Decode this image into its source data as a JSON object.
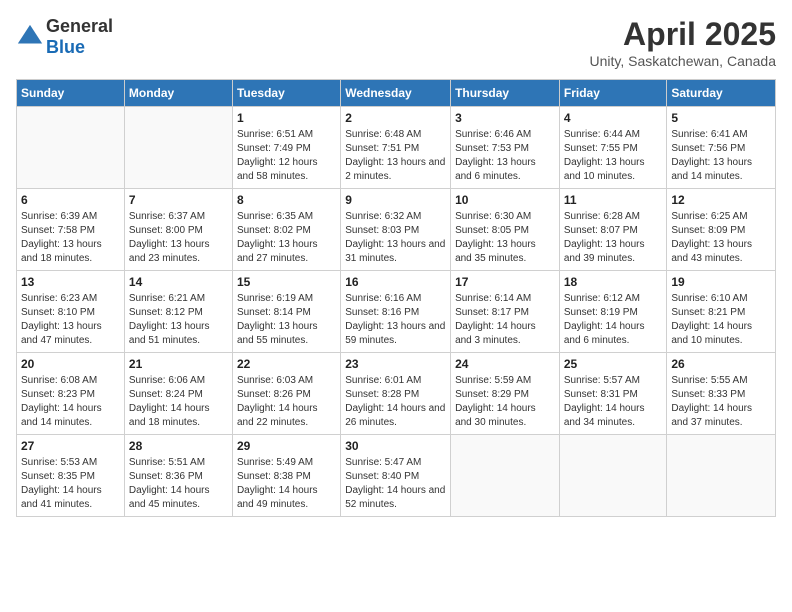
{
  "header": {
    "logo_general": "General",
    "logo_blue": "Blue",
    "month_title": "April 2025",
    "location": "Unity, Saskatchewan, Canada"
  },
  "weekdays": [
    "Sunday",
    "Monday",
    "Tuesday",
    "Wednesday",
    "Thursday",
    "Friday",
    "Saturday"
  ],
  "weeks": [
    [
      {
        "day": "",
        "sunrise": "",
        "sunset": "",
        "daylight": ""
      },
      {
        "day": "",
        "sunrise": "",
        "sunset": "",
        "daylight": ""
      },
      {
        "day": "1",
        "sunrise": "Sunrise: 6:51 AM",
        "sunset": "Sunset: 7:49 PM",
        "daylight": "Daylight: 12 hours and 58 minutes."
      },
      {
        "day": "2",
        "sunrise": "Sunrise: 6:48 AM",
        "sunset": "Sunset: 7:51 PM",
        "daylight": "Daylight: 13 hours and 2 minutes."
      },
      {
        "day": "3",
        "sunrise": "Sunrise: 6:46 AM",
        "sunset": "Sunset: 7:53 PM",
        "daylight": "Daylight: 13 hours and 6 minutes."
      },
      {
        "day": "4",
        "sunrise": "Sunrise: 6:44 AM",
        "sunset": "Sunset: 7:55 PM",
        "daylight": "Daylight: 13 hours and 10 minutes."
      },
      {
        "day": "5",
        "sunrise": "Sunrise: 6:41 AM",
        "sunset": "Sunset: 7:56 PM",
        "daylight": "Daylight: 13 hours and 14 minutes."
      }
    ],
    [
      {
        "day": "6",
        "sunrise": "Sunrise: 6:39 AM",
        "sunset": "Sunset: 7:58 PM",
        "daylight": "Daylight: 13 hours and 18 minutes."
      },
      {
        "day": "7",
        "sunrise": "Sunrise: 6:37 AM",
        "sunset": "Sunset: 8:00 PM",
        "daylight": "Daylight: 13 hours and 23 minutes."
      },
      {
        "day": "8",
        "sunrise": "Sunrise: 6:35 AM",
        "sunset": "Sunset: 8:02 PM",
        "daylight": "Daylight: 13 hours and 27 minutes."
      },
      {
        "day": "9",
        "sunrise": "Sunrise: 6:32 AM",
        "sunset": "Sunset: 8:03 PM",
        "daylight": "Daylight: 13 hours and 31 minutes."
      },
      {
        "day": "10",
        "sunrise": "Sunrise: 6:30 AM",
        "sunset": "Sunset: 8:05 PM",
        "daylight": "Daylight: 13 hours and 35 minutes."
      },
      {
        "day": "11",
        "sunrise": "Sunrise: 6:28 AM",
        "sunset": "Sunset: 8:07 PM",
        "daylight": "Daylight: 13 hours and 39 minutes."
      },
      {
        "day": "12",
        "sunrise": "Sunrise: 6:25 AM",
        "sunset": "Sunset: 8:09 PM",
        "daylight": "Daylight: 13 hours and 43 minutes."
      }
    ],
    [
      {
        "day": "13",
        "sunrise": "Sunrise: 6:23 AM",
        "sunset": "Sunset: 8:10 PM",
        "daylight": "Daylight: 13 hours and 47 minutes."
      },
      {
        "day": "14",
        "sunrise": "Sunrise: 6:21 AM",
        "sunset": "Sunset: 8:12 PM",
        "daylight": "Daylight: 13 hours and 51 minutes."
      },
      {
        "day": "15",
        "sunrise": "Sunrise: 6:19 AM",
        "sunset": "Sunset: 8:14 PM",
        "daylight": "Daylight: 13 hours and 55 minutes."
      },
      {
        "day": "16",
        "sunrise": "Sunrise: 6:16 AM",
        "sunset": "Sunset: 8:16 PM",
        "daylight": "Daylight: 13 hours and 59 minutes."
      },
      {
        "day": "17",
        "sunrise": "Sunrise: 6:14 AM",
        "sunset": "Sunset: 8:17 PM",
        "daylight": "Daylight: 14 hours and 3 minutes."
      },
      {
        "day": "18",
        "sunrise": "Sunrise: 6:12 AM",
        "sunset": "Sunset: 8:19 PM",
        "daylight": "Daylight: 14 hours and 6 minutes."
      },
      {
        "day": "19",
        "sunrise": "Sunrise: 6:10 AM",
        "sunset": "Sunset: 8:21 PM",
        "daylight": "Daylight: 14 hours and 10 minutes."
      }
    ],
    [
      {
        "day": "20",
        "sunrise": "Sunrise: 6:08 AM",
        "sunset": "Sunset: 8:23 PM",
        "daylight": "Daylight: 14 hours and 14 minutes."
      },
      {
        "day": "21",
        "sunrise": "Sunrise: 6:06 AM",
        "sunset": "Sunset: 8:24 PM",
        "daylight": "Daylight: 14 hours and 18 minutes."
      },
      {
        "day": "22",
        "sunrise": "Sunrise: 6:03 AM",
        "sunset": "Sunset: 8:26 PM",
        "daylight": "Daylight: 14 hours and 22 minutes."
      },
      {
        "day": "23",
        "sunrise": "Sunrise: 6:01 AM",
        "sunset": "Sunset: 8:28 PM",
        "daylight": "Daylight: 14 hours and 26 minutes."
      },
      {
        "day": "24",
        "sunrise": "Sunrise: 5:59 AM",
        "sunset": "Sunset: 8:29 PM",
        "daylight": "Daylight: 14 hours and 30 minutes."
      },
      {
        "day": "25",
        "sunrise": "Sunrise: 5:57 AM",
        "sunset": "Sunset: 8:31 PM",
        "daylight": "Daylight: 14 hours and 34 minutes."
      },
      {
        "day": "26",
        "sunrise": "Sunrise: 5:55 AM",
        "sunset": "Sunset: 8:33 PM",
        "daylight": "Daylight: 14 hours and 37 minutes."
      }
    ],
    [
      {
        "day": "27",
        "sunrise": "Sunrise: 5:53 AM",
        "sunset": "Sunset: 8:35 PM",
        "daylight": "Daylight: 14 hours and 41 minutes."
      },
      {
        "day": "28",
        "sunrise": "Sunrise: 5:51 AM",
        "sunset": "Sunset: 8:36 PM",
        "daylight": "Daylight: 14 hours and 45 minutes."
      },
      {
        "day": "29",
        "sunrise": "Sunrise: 5:49 AM",
        "sunset": "Sunset: 8:38 PM",
        "daylight": "Daylight: 14 hours and 49 minutes."
      },
      {
        "day": "30",
        "sunrise": "Sunrise: 5:47 AM",
        "sunset": "Sunset: 8:40 PM",
        "daylight": "Daylight: 14 hours and 52 minutes."
      },
      {
        "day": "",
        "sunrise": "",
        "sunset": "",
        "daylight": ""
      },
      {
        "day": "",
        "sunrise": "",
        "sunset": "",
        "daylight": ""
      },
      {
        "day": "",
        "sunrise": "",
        "sunset": "",
        "daylight": ""
      }
    ]
  ]
}
